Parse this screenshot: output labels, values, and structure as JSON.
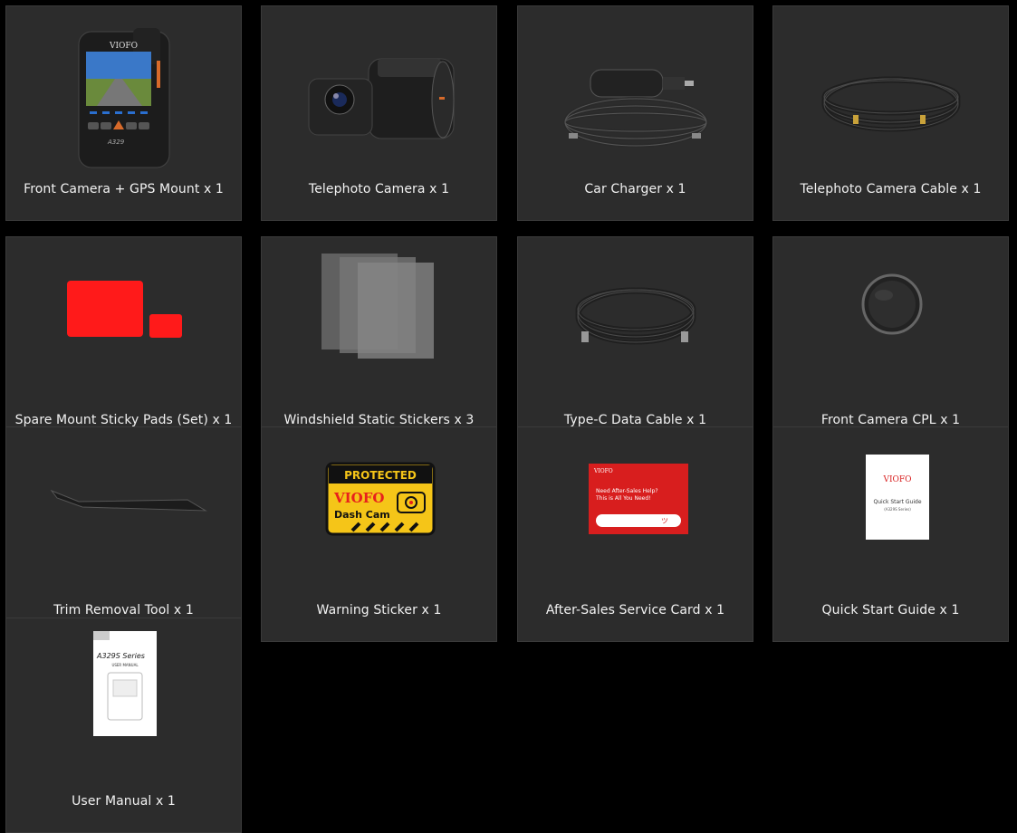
{
  "items": [
    {
      "label": "Front Camera + GPS Mount x 1"
    },
    {
      "label": "Telephoto Camera x 1"
    },
    {
      "label": "Car Charger x 1"
    },
    {
      "label": "Telephoto Camera Cable x 1"
    },
    {
      "label": "Spare Mount Sticky Pads (Set) x 1"
    },
    {
      "label": "Windshield Static Stickers x 3"
    },
    {
      "label": "Type-C Data Cable x 1"
    },
    {
      "label": "Front Camera CPL x 1"
    },
    {
      "label": "Trim Removal Tool x 1"
    },
    {
      "label": "Warning Sticker x 1"
    },
    {
      "label": "After-Sales Service Card x 1"
    },
    {
      "label": "Quick Start Guide x 1"
    },
    {
      "label": "User Manual x 1"
    }
  ],
  "product_text": {
    "brand": "VIOFO",
    "camera_model": "A329",
    "protected": "PROTECTED",
    "warning_brand": "VIOFO",
    "dash_cam": "Dash Cam",
    "card_line1": "Need After-Sales Help?",
    "card_line2": "This is All You Need!",
    "guide_title": "Quick Start Guide",
    "guide_sub": "(A329S Series)",
    "manual_series": "A329S Series",
    "manual_title": "USER MANUAL"
  },
  "colors": {
    "card_bg": "#2c2c2c",
    "page_bg": "#000000",
    "accent_red": "#e8201c",
    "warning_yellow": "#f5c518"
  }
}
